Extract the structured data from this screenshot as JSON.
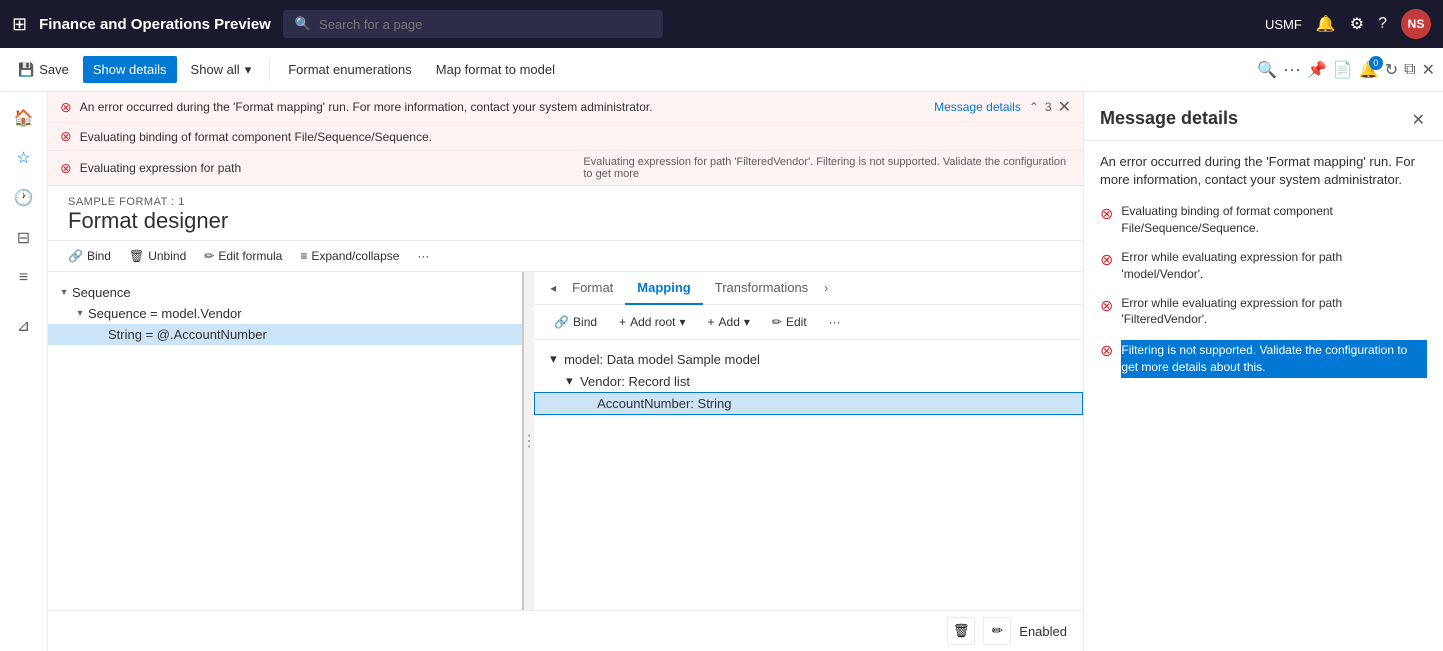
{
  "app": {
    "title": "Finance and Operations Preview",
    "search_placeholder": "Search for a page",
    "org": "USMF"
  },
  "top_nav": {
    "avatar_initials": "NS",
    "bell_icon": "bell",
    "settings_icon": "settings",
    "help_icon": "help"
  },
  "command_bar": {
    "save_label": "Save",
    "show_details_label": "Show details",
    "show_all_label": "Show all",
    "format_enumerations_label": "Format enumerations",
    "map_format_label": "Map format to model"
  },
  "errors": {
    "count": 3,
    "items": [
      {
        "text": "An error occurred during the 'Format mapping' run. For more information, contact your system administrator.",
        "link": "Message details"
      },
      {
        "text": "Evaluating binding of format component File/Sequence/Sequence.",
        "link": null
      },
      {
        "text": "Evaluating expression for path",
        "detail": "Evaluating expression for path 'FilteredVendor'. Filtering is not supported. Validate the configuration to get more",
        "link": null
      }
    ]
  },
  "designer": {
    "subtitle": "SAMPLE FORMAT : 1",
    "title": "Format designer",
    "toolbar": {
      "bind_label": "Bind",
      "unbind_label": "Unbind",
      "edit_formula_label": "Edit formula",
      "expand_collapse_label": "Expand/collapse"
    }
  },
  "left_tree": {
    "items": [
      {
        "label": "Sequence",
        "level": 0,
        "expanded": true
      },
      {
        "label": "Sequence = model.Vendor",
        "level": 1,
        "expanded": true
      },
      {
        "label": "String = @.AccountNumber",
        "level": 2,
        "selected": true
      }
    ]
  },
  "right_pane": {
    "tabs": [
      {
        "label": "Format",
        "active": false
      },
      {
        "label": "Mapping",
        "active": true
      },
      {
        "label": "Transformations",
        "active": false
      }
    ],
    "toolbar": {
      "bind_label": "Bind",
      "add_root_label": "Add root",
      "add_label": "Add",
      "edit_label": "Edit"
    },
    "model_tree": {
      "items": [
        {
          "label": "model: Data model Sample model",
          "level": 0,
          "expanded": true
        },
        {
          "label": "Vendor: Record list",
          "level": 1,
          "expanded": true
        },
        {
          "label": "AccountNumber: String",
          "level": 2,
          "selected": true
        }
      ]
    }
  },
  "bottom_bar": {
    "status": "Enabled",
    "delete_icon": "delete",
    "edit_icon": "edit"
  },
  "message_details": {
    "title": "Message details",
    "intro": "An error occurred during the 'Format mapping' run. For more information, contact your system administrator.",
    "errors": [
      {
        "text": "Evaluating binding of format component File/Sequence/Sequence."
      },
      {
        "text": "Error while evaluating expression for path 'model/Vendor'."
      },
      {
        "text": "Error while evaluating expression for path 'FilteredVendor'."
      },
      {
        "text": "Filtering is not supported. Validate the configuration to get more details about this.",
        "highlighted": true
      }
    ]
  }
}
